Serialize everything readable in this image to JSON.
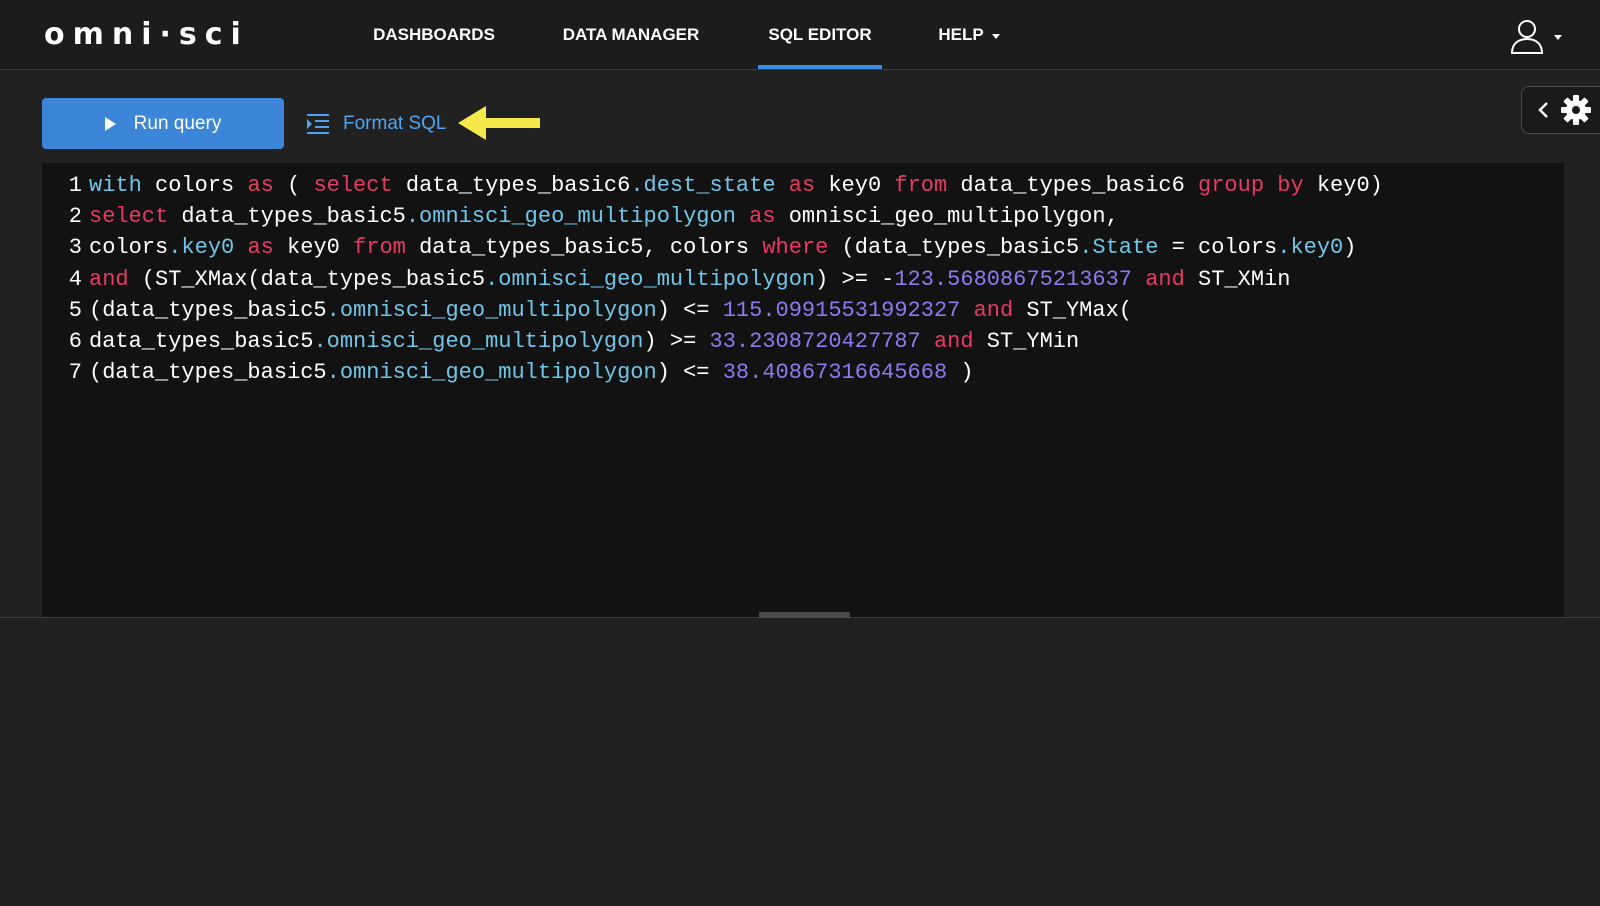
{
  "app": {
    "logo_text": "omni·sci"
  },
  "nav": {
    "items": [
      {
        "label": "DASHBOARDS"
      },
      {
        "label": "DATA MANAGER"
      },
      {
        "label": "SQL EDITOR",
        "active": true
      },
      {
        "label": "HELP",
        "has_dropdown": true
      }
    ],
    "user_icon": "user-icon"
  },
  "toolbar": {
    "run_label": "Run query",
    "format_label": "Format SQL",
    "annotation_icon": "yellow-arrow-icon"
  },
  "side_panel": {
    "collapse_icon": "chevron-left-icon",
    "settings_icon": "gear-icon"
  },
  "editor": {
    "lines": [
      {
        "no": "1",
        "tokens": [
          {
            "t": "with",
            "k": "c"
          },
          {
            "t": " colors ",
            "k": "t"
          },
          {
            "t": "as",
            "k": "k"
          },
          {
            "t": " ( ",
            "k": "t"
          },
          {
            "t": "select",
            "k": "k"
          },
          {
            "t": " data_types_basic6",
            "k": "t"
          },
          {
            "t": ".dest_state",
            "k": "c"
          },
          {
            "t": " ",
            "k": "t"
          },
          {
            "t": "as",
            "k": "k"
          },
          {
            "t": " key0 ",
            "k": "t"
          },
          {
            "t": "from",
            "k": "k"
          },
          {
            "t": " data_types_basic6 ",
            "k": "t"
          },
          {
            "t": "group",
            "k": "k"
          },
          {
            "t": " ",
            "k": "t"
          },
          {
            "t": "by",
            "k": "k"
          },
          {
            "t": " key0)",
            "k": "t"
          }
        ]
      },
      {
        "no": "2",
        "tokens": [
          {
            "t": "select",
            "k": "k"
          },
          {
            "t": " data_types_basic5",
            "k": "t"
          },
          {
            "t": ".omnisci_geo_multipolygon",
            "k": "c"
          },
          {
            "t": " ",
            "k": "t"
          },
          {
            "t": "as",
            "k": "k"
          },
          {
            "t": " omnisci_geo_multipolygon,",
            "k": "t"
          }
        ]
      },
      {
        "no": "3",
        "tokens": [
          {
            "t": "colors",
            "k": "t"
          },
          {
            "t": ".key0",
            "k": "c"
          },
          {
            "t": " ",
            "k": "t"
          },
          {
            "t": "as",
            "k": "k"
          },
          {
            "t": " key0 ",
            "k": "t"
          },
          {
            "t": "from",
            "k": "k"
          },
          {
            "t": " data_types_basic5, colors ",
            "k": "t"
          },
          {
            "t": "where",
            "k": "k"
          },
          {
            "t": " (data_types_basic5",
            "k": "t"
          },
          {
            "t": ".State",
            "k": "c"
          },
          {
            "t": " = colors",
            "k": "t"
          },
          {
            "t": ".key0",
            "k": "c"
          },
          {
            "t": ")",
            "k": "t"
          }
        ]
      },
      {
        "no": "4",
        "tokens": [
          {
            "t": "and",
            "k": "k"
          },
          {
            "t": " (ST_XMax(data_types_basic5",
            "k": "t"
          },
          {
            "t": ".omnisci_geo_multipolygon",
            "k": "c"
          },
          {
            "t": ") >= -",
            "k": "t"
          },
          {
            "t": "123.56808675213637",
            "k": "n"
          },
          {
            "t": " ",
            "k": "t"
          },
          {
            "t": "and",
            "k": "k"
          },
          {
            "t": " ST_XMin",
            "k": "t"
          }
        ]
      },
      {
        "no": "5",
        "tokens": [
          {
            "t": "(data_types_basic5",
            "k": "t"
          },
          {
            "t": ".omnisci_geo_multipolygon",
            "k": "c"
          },
          {
            "t": ") <= ",
            "k": "t"
          },
          {
            "t": "115.09915531992327",
            "k": "n"
          },
          {
            "t": " ",
            "k": "t"
          },
          {
            "t": "and",
            "k": "k"
          },
          {
            "t": " ST_YMax(",
            "k": "t"
          }
        ]
      },
      {
        "no": "6",
        "tokens": [
          {
            "t": "data_types_basic5",
            "k": "t"
          },
          {
            "t": ".omnisci_geo_multipolygon",
            "k": "c"
          },
          {
            "t": ") >= ",
            "k": "t"
          },
          {
            "t": "33.2308720427787",
            "k": "n"
          },
          {
            "t": " ",
            "k": "t"
          },
          {
            "t": "and",
            "k": "k"
          },
          {
            "t": " ST_YMin",
            "k": "t"
          }
        ]
      },
      {
        "no": "7",
        "tokens": [
          {
            "t": "(data_types_basic5",
            "k": "t"
          },
          {
            "t": ".omnisci_geo_multipolygon",
            "k": "c"
          },
          {
            "t": ") <= ",
            "k": "t"
          },
          {
            "t": "38.40867316645668",
            "k": "n"
          },
          {
            "t": " )",
            "k": "t"
          }
        ]
      }
    ]
  },
  "colors": {
    "accent": "#3b86d8",
    "link": "#4ea4f0",
    "keyword": "#e83a60",
    "column": "#71c6e8",
    "number": "#8f79f0",
    "annotation": "#f5e94a"
  }
}
